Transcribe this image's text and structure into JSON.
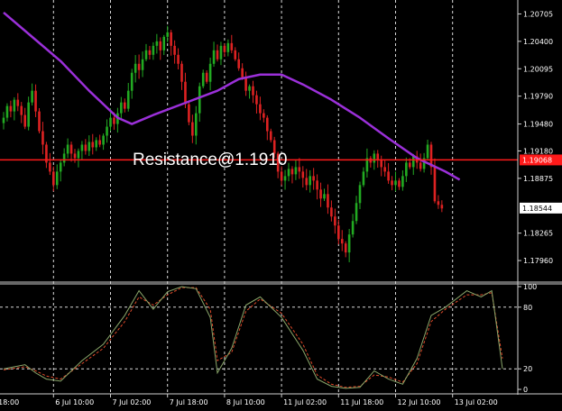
{
  "chart_data": {
    "type": "candlestick",
    "annotation": "Resistance@1.1910",
    "resistance": {
      "value": 1.1908,
      "label": "1.19068",
      "color": "#ff1a1a"
    },
    "current_price": {
      "value": 1.18544,
      "label": "1.18544"
    },
    "price_axis": {
      "range": [
        1.1775,
        1.2082
      ],
      "ticks": [
        {
          "value": 1.20705,
          "label": "1.20705"
        },
        {
          "value": 1.204,
          "label": "1.20400"
        },
        {
          "value": 1.20095,
          "label": "1.20095"
        },
        {
          "value": 1.1979,
          "label": "1.19790"
        },
        {
          "value": 1.1948,
          "label": "1.19480"
        },
        {
          "value": 1.1918,
          "label": "1.19180"
        },
        {
          "value": 1.18875,
          "label": "1.18875"
        },
        {
          "value": 1.18265,
          "label": "1.18265"
        },
        {
          "value": 1.1796,
          "label": "1.17960"
        }
      ]
    },
    "x_axis": {
      "labels": [
        {
          "label": "18:00",
          "bar": -2
        },
        {
          "label": "6 Jul 10:00",
          "bar": 14
        },
        {
          "label": "7 Jul 02:00",
          "bar": 30
        },
        {
          "label": "7 Jul 18:00",
          "bar": 46
        },
        {
          "label": "8 Jul 10:00",
          "bar": 62
        },
        {
          "label": "11 Jul 02:00",
          "bar": 78
        },
        {
          "label": "11 Jul 18:00",
          "bar": 94
        },
        {
          "label": "12 Jul 10:00",
          "bar": 110
        },
        {
          "label": "13 Jul 02:00",
          "bar": 126
        }
      ]
    },
    "candles": {
      "up_color": "#22aa22",
      "down_color": "#dd2222",
      "close": [
        1.1955,
        1.1968,
        1.1962,
        1.1975,
        1.1968,
        1.1958,
        1.1945,
        1.1972,
        1.1985,
        1.1962,
        1.194,
        1.1925,
        1.1905,
        1.1895,
        1.188,
        1.1895,
        1.1905,
        1.1915,
        1.1925,
        1.1915,
        1.191,
        1.1918,
        1.1925,
        1.1918,
        1.1928,
        1.1922,
        1.193,
        1.1925,
        1.1935,
        1.1945,
        1.1955,
        1.1948,
        1.196,
        1.1972,
        1.1965,
        1.1985,
        1.2005,
        1.2015,
        1.2008,
        1.202,
        1.203,
        1.2025,
        1.2035,
        1.204,
        1.203,
        1.2045,
        1.205,
        1.2035,
        1.2025,
        1.2015,
        1.1995,
        1.197,
        1.195,
        1.1935,
        1.196,
        1.199,
        1.2005,
        1.1995,
        1.2015,
        1.203,
        1.202,
        1.2035,
        1.2028,
        1.2038,
        1.203,
        1.202,
        1.201,
        1.2,
        1.1985,
        1.199,
        1.198,
        1.197,
        1.196,
        1.1955,
        1.194,
        1.193,
        1.1915,
        1.1895,
        1.1885,
        1.189,
        1.1898,
        1.1892,
        1.19,
        1.1895,
        1.1888,
        1.188,
        1.189,
        1.1885,
        1.1875,
        1.1865,
        1.187,
        1.1855,
        1.1845,
        1.1835,
        1.182,
        1.1815,
        1.1805,
        1.1825,
        1.184,
        1.186,
        1.188,
        1.1895,
        1.191,
        1.1905,
        1.1915,
        1.1908,
        1.19,
        1.1895,
        1.1885,
        1.188,
        1.1885,
        1.1878,
        1.189,
        1.1905,
        1.19,
        1.1912,
        1.1905,
        1.1898,
        1.191,
        1.1925,
        1.19,
        1.1862,
        1.1858,
        1.1854
      ],
      "mode": "generated_from_close"
    },
    "moving_average": {
      "color": "#9b30d9",
      "points": [
        [
          0,
          1.2072
        ],
        [
          8,
          1.2045
        ],
        [
          16,
          1.2018
        ],
        [
          24,
          1.1985
        ],
        [
          32,
          1.1955
        ],
        [
          36,
          1.1948
        ],
        [
          42,
          1.1958
        ],
        [
          50,
          1.197
        ],
        [
          60,
          1.1985
        ],
        [
          66,
          1.1998
        ],
        [
          72,
          1.2003
        ],
        [
          78,
          1.2003
        ],
        [
          84,
          1.1992
        ],
        [
          92,
          1.1975
        ],
        [
          100,
          1.1955
        ],
        [
          108,
          1.1932
        ],
        [
          116,
          1.191
        ],
        [
          124,
          1.1895
        ],
        [
          128,
          1.1886
        ]
      ]
    },
    "stochastic": {
      "range": [
        0,
        100
      ],
      "ticks": [
        100,
        80,
        20,
        0
      ],
      "levels": [
        80,
        20
      ],
      "main_color": "#8aa66a",
      "signal_color": "#e04a2a",
      "main": [
        [
          0,
          20
        ],
        [
          6,
          24
        ],
        [
          9,
          16
        ],
        [
          12,
          10
        ],
        [
          16,
          8
        ],
        [
          22,
          28
        ],
        [
          28,
          44
        ],
        [
          34,
          72
        ],
        [
          38,
          96
        ],
        [
          42,
          78
        ],
        [
          46,
          95
        ],
        [
          50,
          100
        ],
        [
          54,
          98
        ],
        [
          58,
          70
        ],
        [
          60,
          16
        ],
        [
          64,
          40
        ],
        [
          68,
          82
        ],
        [
          72,
          90
        ],
        [
          78,
          70
        ],
        [
          84,
          38
        ],
        [
          88,
          10
        ],
        [
          92,
          3
        ],
        [
          96,
          1
        ],
        [
          100,
          2
        ],
        [
          104,
          18
        ],
        [
          108,
          10
        ],
        [
          112,
          5
        ],
        [
          116,
          30
        ],
        [
          120,
          72
        ],
        [
          124,
          80
        ],
        [
          130,
          96
        ],
        [
          134,
          90
        ],
        [
          137,
          96
        ],
        [
          140,
          20
        ]
      ],
      "signal": [
        [
          0,
          19
        ],
        [
          6,
          22
        ],
        [
          9,
          18
        ],
        [
          12,
          13
        ],
        [
          16,
          10
        ],
        [
          22,
          25
        ],
        [
          28,
          40
        ],
        [
          34,
          66
        ],
        [
          38,
          90
        ],
        [
          42,
          82
        ],
        [
          46,
          92
        ],
        [
          50,
          99
        ],
        [
          54,
          99
        ],
        [
          58,
          78
        ],
        [
          60,
          28
        ],
        [
          64,
          36
        ],
        [
          68,
          76
        ],
        [
          72,
          88
        ],
        [
          78,
          74
        ],
        [
          84,
          44
        ],
        [
          88,
          14
        ],
        [
          92,
          5
        ],
        [
          96,
          2
        ],
        [
          100,
          3
        ],
        [
          104,
          14
        ],
        [
          108,
          12
        ],
        [
          112,
          7
        ],
        [
          116,
          25
        ],
        [
          120,
          66
        ],
        [
          124,
          78
        ],
        [
          130,
          92
        ],
        [
          134,
          92
        ],
        [
          137,
          94
        ],
        [
          140,
          30
        ]
      ]
    }
  }
}
